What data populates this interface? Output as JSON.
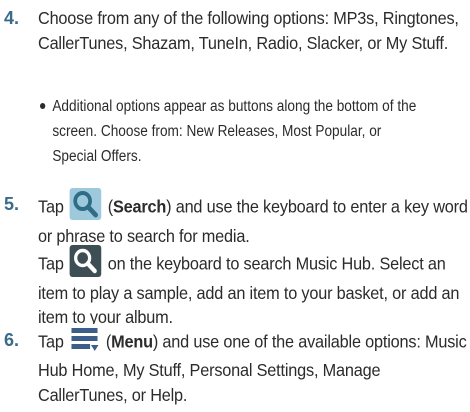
{
  "steps": [
    {
      "number": "4.",
      "text": "Choose from any of the following options: MP3s, Ringtones, CallerTunes, Shazam, TuneIn, Radio, Slacker, or My Stuff.",
      "bullet": "Additional options appear as buttons along the bottom of the screen. Choose from: New Releases, Most Popular, or Special Offers."
    },
    {
      "number": "5.",
      "tap": "Tap",
      "search_label": "Search",
      "after_search": "and use the keyboard to enter a key word or phrase to search for media.",
      "tap2": "Tap",
      "after_kb_icon": "on the keyboard to search Music Hub. Select an item to play a sample, add an item to your basket, or add an item to your album."
    },
    {
      "number": "6.",
      "tap": "Tap",
      "menu_label": "Menu",
      "after_menu": "and use one of the available options: Music Hub Home, My Stuff, Personal Settings, Manage CallerTunes, or Help."
    }
  ],
  "icons": {
    "search_hub": "search-icon",
    "search_keyboard": "keyboard-search-icon",
    "menu": "menu-icon"
  },
  "colors": {
    "step_number": "#3a6b8c",
    "search_icon_bg": "#9ec9dc",
    "keyboard_icon_bg": "#3d4f55",
    "menu_icon": "#3b5f8a"
  }
}
